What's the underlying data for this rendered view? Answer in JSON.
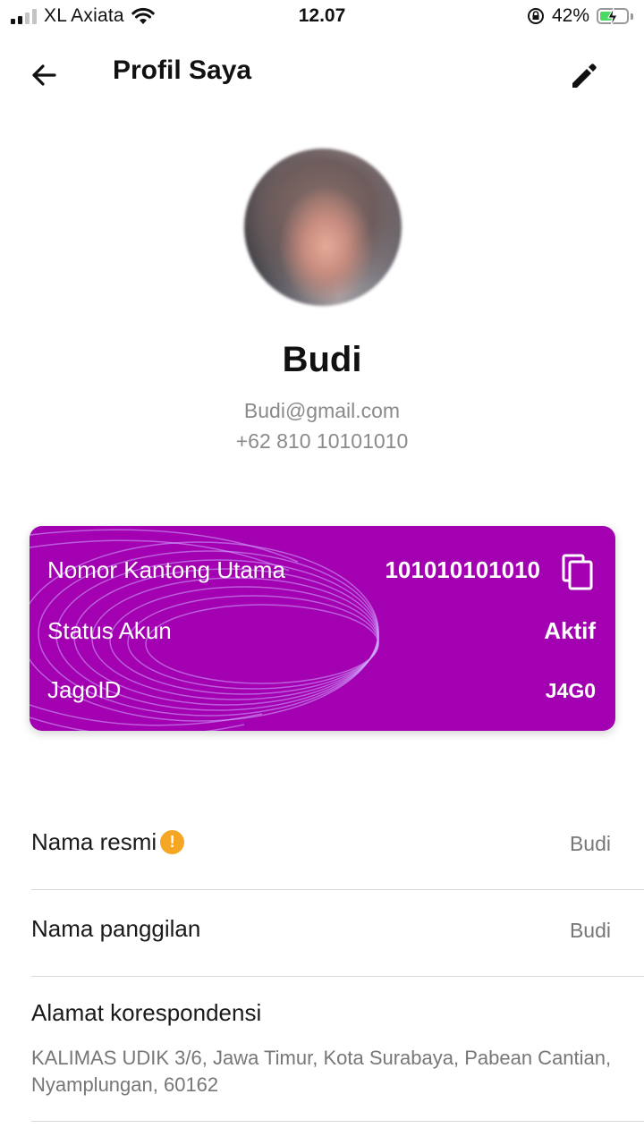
{
  "status_bar": {
    "carrier": "XL Axiata",
    "time": "12.07",
    "battery_percent": "42%",
    "signal_bars": 2,
    "battery_level": 0.42
  },
  "header": {
    "title": "Profil Saya"
  },
  "profile": {
    "name": "Budi",
    "email": "Budi@gmail.com",
    "phone": "+62 810 10101010"
  },
  "card": {
    "bg_color": "#a200b0",
    "rows": [
      {
        "label": "Nomor Kantong Utama",
        "value": "101010101010"
      },
      {
        "label": "Status Akun",
        "value": "Aktif"
      },
      {
        "label": "JagoID",
        "value": "J4G0"
      }
    ]
  },
  "details": {
    "legal_name": {
      "label": "Nama resmi",
      "value": "Budi",
      "warning_icon": "!"
    },
    "nickname": {
      "label": "Nama panggilan",
      "value": "Budi"
    },
    "address": {
      "label": "Alamat korespondensi",
      "value": "KALIMAS UDIK 3/6, Jawa Timur, Kota Surabaya, Pabean Cantian, Nyamplungan, 60162"
    }
  },
  "icons": {
    "back": "arrow-left-icon",
    "edit": "pencil-icon",
    "copy": "copy-icon",
    "warning": "warning-icon"
  }
}
